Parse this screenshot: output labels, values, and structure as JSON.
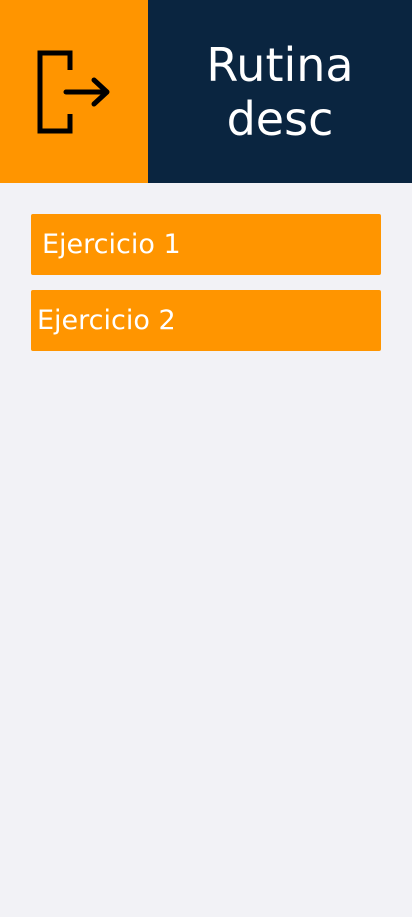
{
  "header": {
    "exit_icon": "logout-icon",
    "title": "Rutina desc"
  },
  "exercises": [
    {
      "label": "Ejercicio 1"
    },
    {
      "label": "Ejercicio 2"
    }
  ],
  "colors": {
    "accent": "#ff9500",
    "header_dark": "#0a2540",
    "background": "#f2f2f6",
    "text_light": "#ffffff"
  }
}
